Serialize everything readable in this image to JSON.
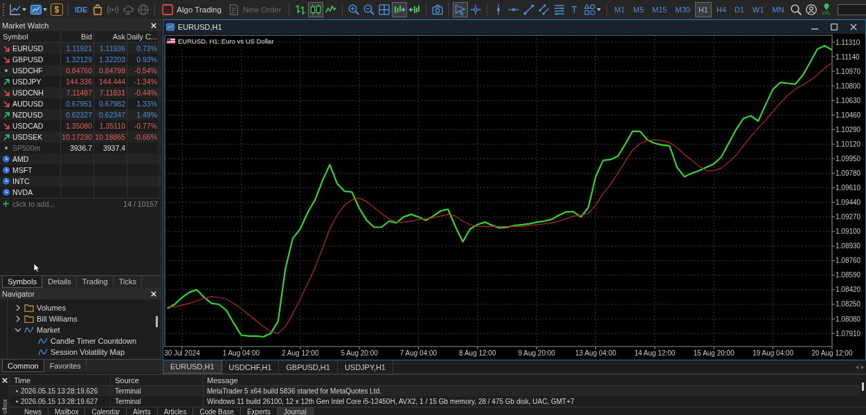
{
  "toolbar": {
    "funds_label": "$",
    "ide_label": "IDE",
    "services": [
      {
        "disabled": false
      },
      {
        "disabled": true
      },
      {
        "disabled": true
      },
      {
        "disabled": true
      }
    ],
    "algo_trading": {
      "label": "Algo Trading",
      "on": false
    },
    "new_order": {
      "label": "New Order",
      "disabled": true
    },
    "chart_types": [
      {
        "selected": false
      },
      {
        "selected": true
      },
      {
        "selected": false
      }
    ],
    "auto_scroll": {
      "on": true
    },
    "chart_shift": {
      "on": false
    },
    "pointer_tools": [
      {
        "selected": true
      },
      {
        "selected": false
      }
    ],
    "text_tool_label": "T",
    "timeframes": [
      {
        "label": "M1",
        "selected": false
      },
      {
        "label": "M5",
        "selected": false
      },
      {
        "label": "M15",
        "selected": false
      },
      {
        "label": "M30",
        "selected": false
      },
      {
        "label": "H1",
        "selected": true
      },
      {
        "label": "H4",
        "selected": false
      },
      {
        "label": "D1",
        "selected": false
      },
      {
        "label": "W1",
        "selected": false
      },
      {
        "label": "MN",
        "selected": false
      }
    ],
    "level_label": "LVL"
  },
  "market_watch": {
    "title": "Market Watch",
    "columns": [
      "Symbol",
      "Bid",
      "Ask",
      "Daily C..."
    ],
    "rows": [
      {
        "symbol": "EURUSD",
        "kind": "falling",
        "color": "#4f8fdc",
        "bid": "1.11921",
        "ask": "1.11936",
        "daily_change": "0.73%",
        "disabled": false
      },
      {
        "symbol": "GBPUSD",
        "kind": "falling",
        "color": "#4f8fdc",
        "bid": "1.32129",
        "ask": "1.32203",
        "daily_change": "0.93%",
        "disabled": false
      },
      {
        "symbol": "USDCHF",
        "kind": "steady",
        "color": "#e0625c",
        "bid": "0.84760",
        "ask": "0.84799",
        "daily_change": "-0.54%",
        "disabled": false
      },
      {
        "symbol": "USDJPY",
        "kind": "rising",
        "color": "#e0625c",
        "bid": "144.336",
        "ask": "144.444",
        "daily_change": "-1.34%",
        "disabled": false
      },
      {
        "symbol": "USDCNH",
        "kind": "falling",
        "color": "#e0625c",
        "bid": "7.11487",
        "ask": "7.11831",
        "daily_change": "-0.44%",
        "disabled": false
      },
      {
        "symbol": "AUDUSD",
        "kind": "falling",
        "color": "#4f8fdc",
        "bid": "0.67951",
        "ask": "0.67982",
        "daily_change": "1.33%",
        "disabled": false
      },
      {
        "symbol": "NZDUSD",
        "kind": "rising",
        "color": "#4f8fdc",
        "bid": "0.62327",
        "ask": "0.62347",
        "daily_change": "1.49%",
        "disabled": false
      },
      {
        "symbol": "USDCAD",
        "kind": "falling",
        "color": "#e0625c",
        "bid": "1.35080",
        "ask": "1.35110",
        "daily_change": "-0.77%",
        "disabled": false
      },
      {
        "symbol": "USDSEK",
        "kind": "rising",
        "color": "#e0625c",
        "bid": "10.17230",
        "ask": "10.18865",
        "daily_change": "-0.66%",
        "disabled": false
      },
      {
        "symbol": "SP500m",
        "kind": "steady",
        "color": "#e2e2e2",
        "bid": "3936.7",
        "ask": "3937.4",
        "disabled": true
      },
      {
        "symbol": "AMD",
        "kind": "closed",
        "disabled": false
      },
      {
        "symbol": "MSFT",
        "kind": "closed",
        "disabled": false
      },
      {
        "symbol": "INTC",
        "kind": "closed",
        "disabled": false
      },
      {
        "symbol": "NVDA",
        "kind": "closed",
        "disabled": false
      }
    ],
    "add_hint": "click to add...",
    "count": "14 / 10157",
    "tabs": [
      {
        "label": "Symbols",
        "selected": true
      },
      {
        "label": "Details",
        "selected": false
      },
      {
        "label": "Trading",
        "selected": false
      },
      {
        "label": "Ticks",
        "selected": false
      }
    ]
  },
  "navigator": {
    "title": "Navigator",
    "items": [
      {
        "label": "Volumes",
        "kind": "folder",
        "expanded": false
      },
      {
        "label": "Bill Williams",
        "kind": "folder",
        "expanded": false
      },
      {
        "label": "Market",
        "kind": "indicator",
        "expanded": true,
        "children": [
          {
            "label": "Candle Timer Countdown",
            "kind": "indicator"
          },
          {
            "label": "Session Volatility Map",
            "kind": "indicator"
          }
        ]
      }
    ],
    "tabs": [
      {
        "label": "Common",
        "selected": true
      },
      {
        "label": "Favorites",
        "selected": false
      }
    ]
  },
  "chart_window": {
    "title": "EURUSD,H1",
    "chart_data": {
      "type": "line",
      "title": "EURUSD, H1: Euro vs US Dollar",
      "grid": true,
      "ylim": [
        1.07757,
        1.11391
      ],
      "categories": [
        null,
        null,
        "30 Jul 2024",
        null,
        null,
        null,
        null,
        null,
        null,
        null,
        "1 Aug 04:00",
        null,
        null,
        null,
        null,
        null,
        null,
        null,
        "2 Aug 12:00",
        null,
        null,
        null,
        null,
        null,
        null,
        null,
        "5 Aug 20:00",
        null,
        null,
        null,
        null,
        null,
        null,
        null,
        "7 Aug 04:00",
        null,
        null,
        null,
        null,
        null,
        null,
        null,
        "8 Aug 12:00",
        null,
        null,
        null,
        null,
        null,
        null,
        null,
        "9 Aug 20:00",
        null,
        null,
        null,
        null,
        null,
        null,
        null,
        "13 Aug 04:00",
        null,
        null,
        null,
        null,
        null,
        null,
        null,
        "14 Aug 12:00",
        null,
        null,
        null,
        null,
        null,
        null,
        null,
        "15 Aug 20:00",
        null,
        null,
        null,
        null,
        null,
        null,
        null,
        "19 Aug 04:00",
        null,
        null,
        null,
        null,
        null,
        null,
        null,
        "20 Aug 12:00"
      ],
      "yticks": [
        {
          "value": 1.1131,
          "label": "1.11310"
        },
        {
          "value": 1.1114,
          "label": "1.11140"
        },
        {
          "value": 1.1097,
          "label": "1.10970"
        },
        {
          "value": 1.108,
          "label": "1.10800"
        },
        {
          "value": 1.1063,
          "label": "1.10630"
        },
        {
          "value": 1.1046,
          "label": "1.10460"
        },
        {
          "value": 1.1029,
          "label": "1.10290"
        },
        {
          "value": 1.1012,
          "label": "1.10120"
        },
        {
          "value": 1.0995,
          "label": "1.09950"
        },
        {
          "value": 1.0978,
          "label": "1.09780"
        },
        {
          "value": 1.0961,
          "label": "1.09610"
        },
        {
          "value": 1.0944,
          "label": "1.09440"
        },
        {
          "value": 1.0927,
          "label": "1.09270"
        },
        {
          "value": 1.091,
          "label": "1.09100"
        },
        {
          "value": 1.0893,
          "label": "1.08930"
        },
        {
          "value": 1.0876,
          "label": "1.08760"
        },
        {
          "value": 1.0859,
          "label": "1.08590"
        },
        {
          "value": 1.0842,
          "label": "1.08420"
        },
        {
          "value": 1.0825,
          "label": "1.08250"
        },
        {
          "value": 1.0808,
          "label": "1.08080"
        },
        {
          "value": 1.0791,
          "label": "1.07910"
        }
      ],
      "series": [
        {
          "color": "#33d633",
          "values": [
            1.082,
            1.0825,
            1.0833,
            1.0839,
            1.0842,
            1.0833,
            1.0826,
            1.0825,
            1.0818,
            1.0803,
            1.0789,
            1.0788,
            1.0788,
            1.0787,
            1.0791,
            1.0805,
            1.0867,
            1.0902,
            1.0913,
            1.0932,
            1.0947,
            1.0969,
            1.0988,
            1.0966,
            1.0957,
            1.0956,
            1.0937,
            1.0923,
            1.0915,
            1.0915,
            1.0922,
            1.092,
            1.0927,
            1.093,
            1.0927,
            1.0923,
            1.0928,
            1.0934,
            1.0936,
            1.0916,
            1.0898,
            1.0913,
            1.0918,
            1.0921,
            1.0917,
            1.0914,
            1.0915,
            1.0917,
            1.0918,
            1.0919,
            1.0921,
            1.0922,
            1.0924,
            1.0929,
            1.0933,
            1.0933,
            1.0927,
            1.0938,
            1.0974,
            1.0993,
            1.0994,
            1.0998,
            1.1012,
            1.1027,
            1.1027,
            1.1017,
            1.1013,
            1.1011,
            1.101,
            1.0985,
            1.0974,
            1.0978,
            1.0981,
            1.0985,
            1.0989,
            1.0997,
            1.1013,
            1.1029,
            1.1042,
            1.1045,
            1.1039,
            1.1058,
            1.1076,
            1.1084,
            1.1083,
            1.1082,
            1.1092,
            1.1107,
            1.1123,
            1.1127,
            1.1122
          ]
        },
        {
          "color": "#b52a2a",
          "values": [
            1.0822,
            1.0822,
            1.0824,
            1.0826,
            1.0829,
            1.0832,
            1.0834,
            1.0833,
            1.0831,
            1.0826,
            1.082,
            1.0813,
            1.0806,
            1.0799,
            1.0793,
            1.0791,
            1.0799,
            1.0814,
            1.0831,
            1.0849,
            1.0868,
            1.089,
            1.0913,
            1.0929,
            1.0941,
            1.0947,
            1.0949,
            1.0945,
            1.0938,
            1.0931,
            1.0925,
            1.0921,
            1.0921,
            1.0922,
            1.0924,
            1.0925,
            1.0926,
            1.0928,
            1.093,
            1.0928,
            1.0922,
            1.0918,
            1.0916,
            1.0916,
            1.0916,
            1.0916,
            1.0916,
            1.0916,
            1.0916,
            1.0917,
            1.0918,
            1.0919,
            1.092,
            1.0922,
            1.0925,
            1.0928,
            1.0929,
            1.0931,
            1.0941,
            1.0954,
            1.0965,
            1.0978,
            1.0992,
            1.1005,
            1.1013,
            1.1016,
            1.1017,
            1.1016,
            1.1014,
            1.1008,
            1.1,
            1.0993,
            1.0986,
            1.0981,
            1.0981,
            1.0984,
            1.0991,
            1.0999,
            1.101,
            1.1021,
            1.1031,
            1.104,
            1.105,
            1.106,
            1.1069,
            1.1076,
            1.1081,
            1.1086,
            1.1093,
            1.1101,
            1.1107
          ]
        }
      ]
    }
  },
  "chart_tabs": [
    {
      "label": "EURUSD,H1",
      "selected": true
    },
    {
      "label": "USDCHF,H1",
      "selected": false
    },
    {
      "label": "GBPUSD,H1",
      "selected": false
    },
    {
      "label": "USDJPY,H1",
      "selected": false
    }
  ],
  "toolbox": {
    "side_label": "olbox",
    "columns": [
      "Time",
      "Source",
      "Message"
    ],
    "rows": [
      {
        "time": "2026.05.15 13:28:19.626",
        "source": "Terminal",
        "message": "MetaTrader 5 x64 build 5836 started for MetaQuotes Ltd."
      },
      {
        "time": "2026.05.15 13:28:19.627",
        "source": "Terminal",
        "message": "Windows 11 build 26100, 12 x 12th Gen Intel Core i5-12450H, AVX2, 1 / 15 Gb memory, 28 / 475 Gb disk, UAC, GMT+7"
      }
    ],
    "tabs": [
      {
        "label": "News",
        "selected": false
      },
      {
        "label": "Mailbox",
        "selected": false
      },
      {
        "label": "Calendar",
        "selected": false
      },
      {
        "label": "Alerts",
        "selected": false
      },
      {
        "label": "Articles",
        "selected": false
      },
      {
        "label": "Code Base",
        "selected": false
      },
      {
        "label": "Experts",
        "selected": false
      },
      {
        "label": "Journal",
        "selected": true
      }
    ]
  }
}
